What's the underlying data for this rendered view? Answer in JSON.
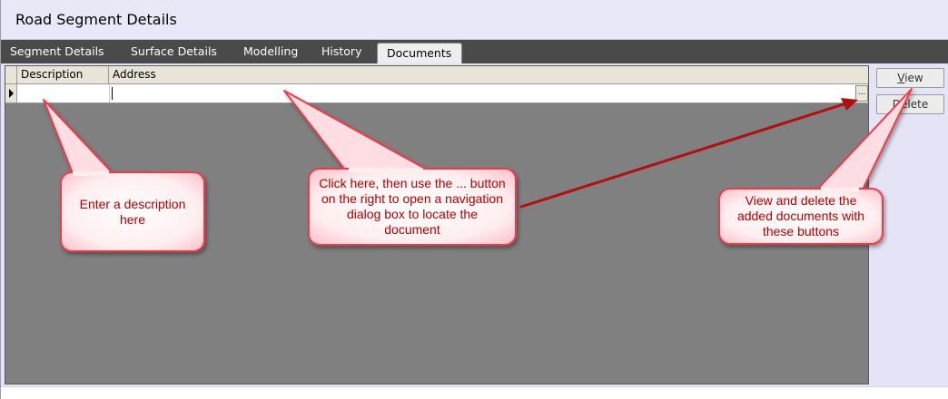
{
  "window": {
    "title": "Road Segment Details"
  },
  "tabs": [
    {
      "label": "Segment Details",
      "active": false
    },
    {
      "label": "Surface Details",
      "active": false
    },
    {
      "label": "Modelling",
      "active": false
    },
    {
      "label": "History",
      "active": false
    },
    {
      "label": "Documents",
      "active": true
    }
  ],
  "grid": {
    "columns": [
      "Description",
      "Address"
    ],
    "rows": [
      {
        "description": "",
        "address": ""
      }
    ],
    "browse_label": "..."
  },
  "buttons": {
    "view": {
      "mnemonic": "V",
      "rest": "iew"
    },
    "delete": {
      "mnemonic": "D",
      "rest": "elete"
    }
  },
  "callouts": {
    "description": "Enter a description here",
    "address": "Click here, then use the ... button on the right to open a navigation dialog box to locate the document",
    "buttons": "View and delete the added documents with these buttons"
  },
  "colors": {
    "tab_bar": "#4a4a4a",
    "grid_background": "#808080",
    "callout_fill": "#ffe6ea",
    "callout_border": "#ee3a4a",
    "callout_text": "#b00000",
    "arrow": "#b01010"
  }
}
